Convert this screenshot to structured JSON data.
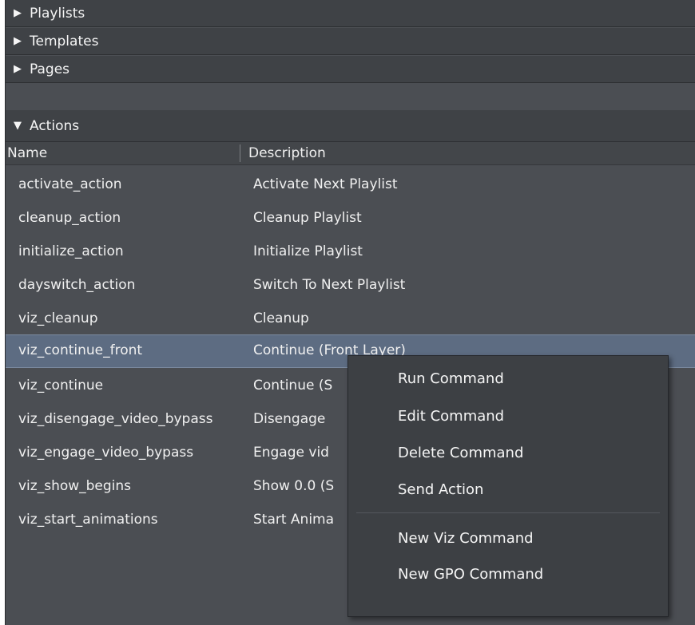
{
  "sections": [
    {
      "label": "Playlists",
      "arrow": "▶"
    },
    {
      "label": "Templates",
      "arrow": "▶"
    },
    {
      "label": "Pages",
      "arrow": "▶"
    },
    {
      "label": "Actions",
      "arrow": "▼"
    }
  ],
  "table": {
    "columns": [
      "Name",
      "Description"
    ],
    "rows": [
      {
        "name": "activate_action",
        "description": "Activate Next Playlist"
      },
      {
        "name": "cleanup_action",
        "description": "Cleanup Playlist"
      },
      {
        "name": "initialize_action",
        "description": "Initialize Playlist"
      },
      {
        "name": "dayswitch_action",
        "description": "Switch To Next Playlist"
      },
      {
        "name": "viz_cleanup",
        "description": "Cleanup"
      },
      {
        "name": "viz_continue_front",
        "description": "Continue (Front Layer)"
      },
      {
        "name": "viz_continue",
        "description": "Continue (S"
      },
      {
        "name": "viz_disengage_video_bypass",
        "description": "Disengage"
      },
      {
        "name": "viz_engage_video_bypass",
        "description": "Engage vid"
      },
      {
        "name": "viz_show_begins",
        "description": "Show 0.0 (S"
      },
      {
        "name": "viz_start_animations",
        "description": "Start Anima"
      }
    ]
  },
  "context_menu": {
    "items": [
      "Run Command",
      "Edit Command",
      "Delete Command",
      "Send Action"
    ],
    "extra_items": [
      "New Viz Command",
      "New GPO Command"
    ]
  },
  "colors": {
    "panel_bg": "#4b4e53",
    "header_bg": "#3f4246",
    "selected_row": "#5d6c82",
    "menu_bg": "#3d4044"
  }
}
